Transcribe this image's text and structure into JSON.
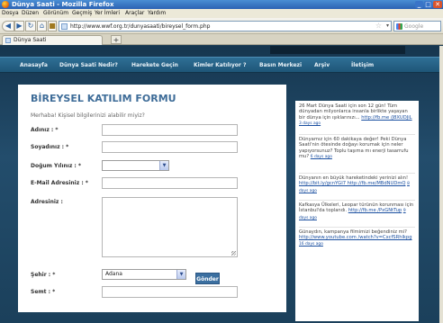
{
  "window": {
    "title": "Dünya Saati - Mozilla Firefox"
  },
  "menu": [
    "Dosya",
    "Düzen",
    "Görünüm",
    "Geçmiş",
    "Yer İmleri",
    "Araçlar",
    "Yardım"
  ],
  "toolbar": {
    "url": "http://www.wwf.org.tr/dunyasaati/bireysel_form.php",
    "search_placeholder": "Google",
    "back_icon": "back-arrow-icon",
    "forward_icon": "forward-arrow-icon",
    "reload_icon": "reload-icon",
    "home_icon": "home-icon"
  },
  "tabs": [
    {
      "label": "Dünya Saati"
    }
  ],
  "site_nav": [
    "Anasayfa",
    "Dünya Saati Nedir?",
    "Harekete Geçin",
    "Kimler Katılıyor ?",
    "Basın Merkezi",
    "Arşiv",
    "İletişim"
  ],
  "form": {
    "title": "BİREYSEL KATILIM FORMU",
    "subtitle": "Merhaba! Kişisel bilgilerinizi alabilir miyiz?",
    "fields": {
      "name": "Adınız : *",
      "surname": "Soyadınız : *",
      "birth_year": "Doğum Yılınız : *",
      "email": "E-Mail Adresiniz : *",
      "address": "Adresiniz :",
      "city": "Şehir : *",
      "district": "Semt : *"
    },
    "city_value": "Adana",
    "birth_year_value": "",
    "submit": "Gönder"
  },
  "feed": [
    {
      "text": "26 Mart Dünya Saati için son 12 gün! Tüm dünyadan milyonlarca insanla birlikte yaşayan bir dünya için ışıklarınızı...",
      "link": "http://fb.me /J8XUDJiL",
      "ago": "3 days ago"
    },
    {
      "text": "Dünyamız için 60 dakikaya değer! Peki Dünya Saati'nin ötesinde doğayı korumak için neler yapıyorsunuz? Toplu taşıma mı enerji tasarrufu mu?",
      "link": "",
      "ago": "6 days ago"
    },
    {
      "text": "Dünyanın en büyük hareketindeki yerinizi alın!",
      "link": "http://bit.ly/gcnYGI7 http://fb.me/MBdNUDmQ",
      "ago": "8 days ago"
    },
    {
      "text": "Kafkasya Ülkeleri, Leopar türünün korunması için İstanbul'da toplandı.",
      "link": "http://fb.me /PxGNtTup",
      "ago": "9 days ago"
    },
    {
      "text": "Günaydın, kampanya filmimizi beğendiniz mi?",
      "link": "http://www.youtube.com /watch?v=CxcfSRhlkpg",
      "ago": "16 days ago"
    }
  ]
}
